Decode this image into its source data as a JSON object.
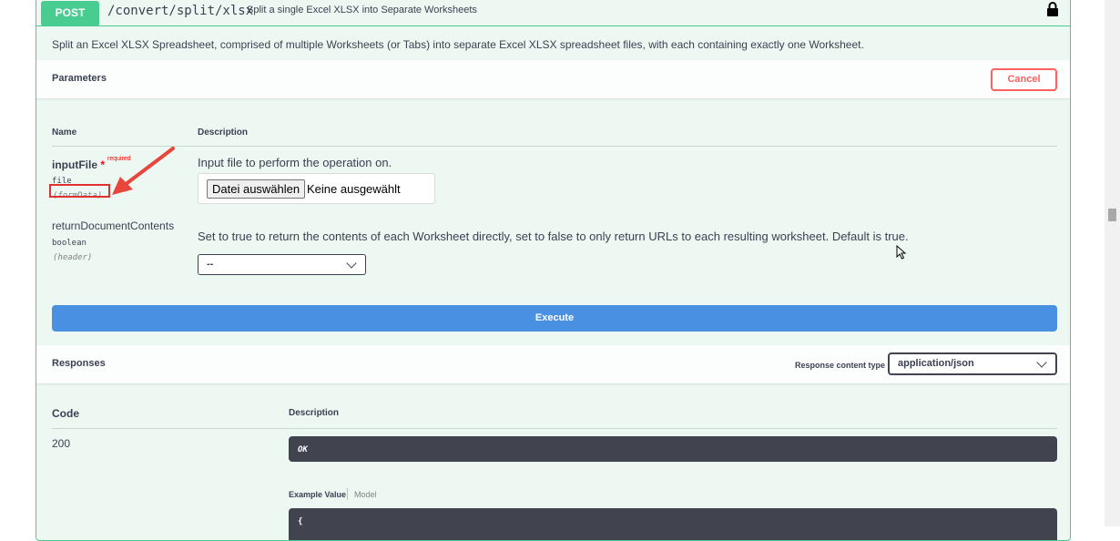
{
  "operation": {
    "method": "POST",
    "path": "/convert/split/xlsx",
    "summary": "Split a single Excel XLSX into Separate Worksheets",
    "description": "Split an Excel XLSX Spreadsheet, comprised of multiple Worksheets (or Tabs) into separate Excel XLSX spreadsheet files, with each containing exactly one Worksheet.",
    "lock_icon": "lock-icon"
  },
  "parameters": {
    "title": "Parameters",
    "cancel_label": "Cancel",
    "col_name": "Name",
    "col_description": "Description",
    "items": [
      {
        "name": "inputFile",
        "required_star": "*",
        "required_label": "required",
        "type": "file",
        "in": "(formData)",
        "description": "Input file to perform the operation on.",
        "file_button": "Datei auswählen",
        "file_status": "Keine ausgewählt"
      },
      {
        "name": "returnDocumentContents",
        "type": "boolean",
        "in": "(header)",
        "description": "Set to true to return the contents of each Worksheet directly, set to false to only return URLs to each resulting worksheet. Default is true.",
        "select_value": "--"
      }
    ],
    "execute_label": "Execute"
  },
  "responses": {
    "title": "Responses",
    "content_type_label": "Response content type",
    "content_type_value": "application/json",
    "col_code": "Code",
    "col_description": "Description",
    "rows": [
      {
        "code": "200",
        "description": "OK",
        "example_tab": "Example Value",
        "model_tab": "Model",
        "example_start": "{"
      }
    ]
  },
  "colors": {
    "post_green": "#49cc90",
    "execute_blue": "#4990e2",
    "cancel_red": "#ff6060",
    "annotation_red": "#e03030"
  }
}
